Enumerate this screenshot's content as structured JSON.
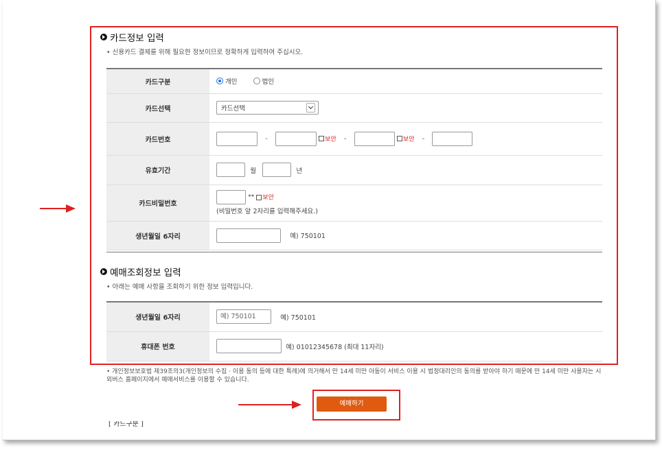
{
  "card_section": {
    "title": "카드정보 입력",
    "desc": "• 신용카드 결제를 위해 필요한 정보이므로 정확하게 입력하여 주십시오.",
    "rows": {
      "card_type": {
        "label": "카드구분",
        "option_personal": "개인",
        "option_corporate": "법인"
      },
      "card_select": {
        "label": "카드선택",
        "value": "카드선택"
      },
      "card_number": {
        "label": "카드번호",
        "dash": "-",
        "security": "보안"
      },
      "expiry": {
        "label": "유효기간",
        "month": "월",
        "year": "년"
      },
      "password": {
        "label": "카드비밀번호",
        "stars": "**",
        "security": "보안",
        "hint": "(비밀번호 앞 2자리를 입력해주세요.)"
      },
      "birth": {
        "label": "생년월일 6자리",
        "example": "예) 750101"
      }
    }
  },
  "reservation_section": {
    "title": "예매조회정보 입력",
    "desc": "• 아래는 예매 사항을 조회하기 위한 정보 입력입니다.",
    "rows": {
      "birth": {
        "label": "생년월일 6자리",
        "placeholder": "예) 750101",
        "example": "예) 750101"
      },
      "phone": {
        "label": "휴대폰 번호",
        "example": "예) 01012345678 (최대 11자리)"
      }
    }
  },
  "notice": "• 개인정보보호법 제39조의3(개인정보의 수집 · 이용 동의 등에 대한 특례)에 의거해서 만 14세 미만 아동이 서비스 이용 시 법정대리인의 동의를 받아야 하기 때문에 만 14세 미만 사용자는 시외버스 홈페이지에서 예매서비스를 이용할 수 있습니다.",
  "submit_label": "예매하기",
  "next_section_cut": "[ 카드구분 ]",
  "colors": {
    "highlight": "#e02020",
    "button": "#e05a10",
    "radio_selected": "#1a73e8",
    "security_text": "#d22222"
  }
}
